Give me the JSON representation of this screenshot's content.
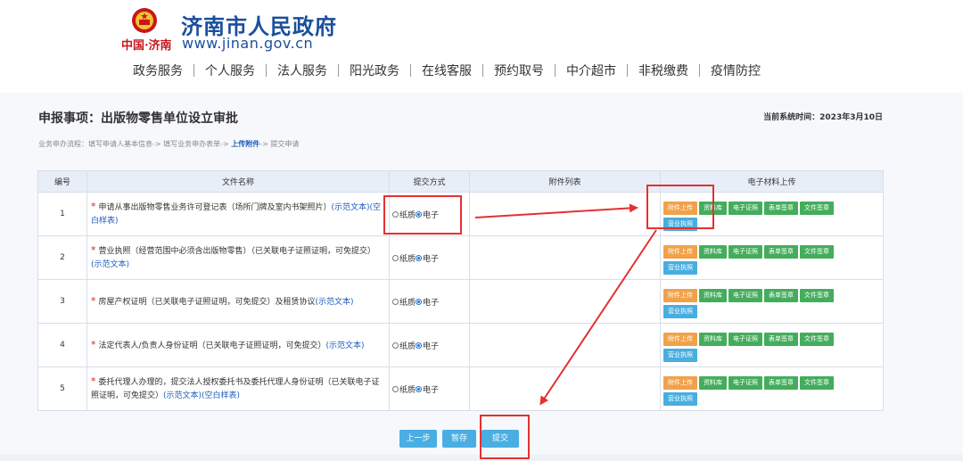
{
  "header": {
    "site_title": "济南市人民政府",
    "site_url": "www.jinan.gov.cn",
    "logo_text": "中国·济南",
    "nav": [
      "政务服务",
      "个人服务",
      "法人服务",
      "阳光政务",
      "在线客服",
      "预约取号",
      "中介超市",
      "非税缴费",
      "疫情防控"
    ]
  },
  "main": {
    "title": "申报事项：出版物零售单位设立审批",
    "system_time": "当前系统时间：2023年3月10日",
    "flow": {
      "prefix": "业务申办流程：填写申请人基本信息-> 填写业务申办表单-> ",
      "current": "上传附件",
      "suffix": "-> 提交申请"
    },
    "table": {
      "headers": [
        "编号",
        "文件名称",
        "提交方式",
        "附件列表",
        "电子材料上传"
      ],
      "mode_paper": "纸质",
      "mode_electronic": "电子",
      "buttons": {
        "upload": "附件上传",
        "library": "资料库",
        "e_cert": "电子证照",
        "form_sign": "表单签章",
        "file_sign": "文件签章",
        "license": "营业执照"
      },
      "rows": [
        {
          "num": "1",
          "name": "申请从事出版物零售业务许可登记表（场所门牌及室内书架照片）",
          "links": [
            "(示范文本)",
            "(空白样表)"
          ]
        },
        {
          "num": "2",
          "name": "营业执照（经营范围中必须含出版物零售）（已关联电子证照证明，可免提交）",
          "links": [
            "(示范文本)"
          ]
        },
        {
          "num": "3",
          "name": "房屋产权证明（已关联电子证照证明，可免提交）及租赁协议",
          "links": [
            "(示范文本)"
          ]
        },
        {
          "num": "4",
          "name": "法定代表人/负责人身份证明（已关联电子证照证明，可免提交）",
          "links": [
            "(示范文本)"
          ]
        },
        {
          "num": "5",
          "name": "委托代理人办理的，提交法人授权委托书及委托代理人身份证明（已关联电子证照证明，可免提交）",
          "links": [
            "(示范文本)",
            "(空白样表)"
          ]
        }
      ]
    },
    "actions": {
      "prev": "上一步",
      "save": "暂存",
      "submit": "提交"
    }
  },
  "colors": {
    "brand_blue": "#1a4f9c",
    "annotation_red": "#e53030",
    "btn_orange": "#f0a24a",
    "btn_green": "#44ad5c",
    "btn_blue": "#48aee0"
  }
}
